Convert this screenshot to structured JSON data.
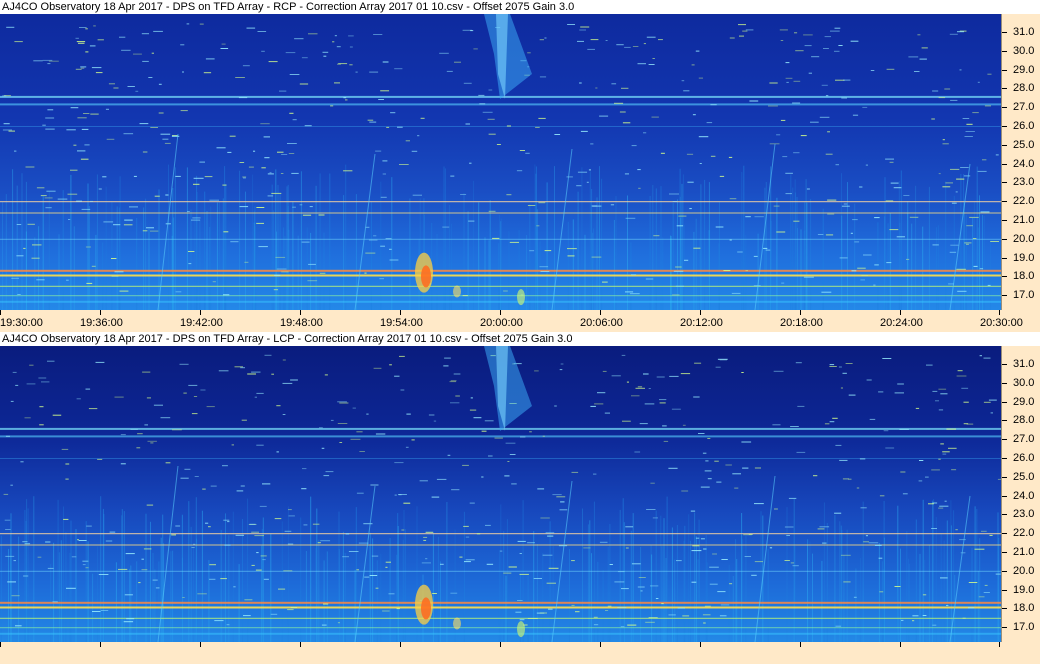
{
  "panels": [
    {
      "title": "AJ4CO Observatory 18 Apr 2017  -  DPS on TFD Array  -  RCP  -  Correction Array 2017 01 10.csv  -  Offset 2075  Gain 3.0",
      "x_tick_labels": [
        "19:30:00",
        "19:36:00",
        "19:42:00",
        "19:48:00",
        "19:54:00",
        "20:00:00",
        "20:06:00",
        "20:12:00",
        "20:18:00",
        "20:24:00",
        "20:30:00"
      ]
    },
    {
      "title": "AJ4CO Observatory 18 Apr 2017  -  DPS on TFD Array  -  LCP  -  Correction Array 2017 01 10.csv  -  Offset 2075  Gain 3.0",
      "x_tick_labels": []
    }
  ],
  "y_tick_labels": [
    "31.0",
    "30.0",
    "29.0",
    "28.0",
    "27.0",
    "26.0",
    "25.0",
    "24.0",
    "23.0",
    "22.0",
    "21.0",
    "20.0",
    "19.0",
    "18.0",
    "17.0"
  ],
  "chart_data": {
    "type": "heatmap",
    "title": "",
    "xlabel": "",
    "ylabel": "",
    "x_range": [
      "19:30:00",
      "20:30:00"
    ],
    "x_ticks": [
      "19:30:00",
      "19:36:00",
      "19:42:00",
      "19:48:00",
      "19:54:00",
      "20:00:00",
      "20:06:00",
      "20:12:00",
      "20:18:00",
      "20:24:00",
      "20:30:00"
    ],
    "y_ticks_mhz": [
      31.0,
      30.0,
      29.0,
      28.0,
      27.0,
      26.0,
      25.0,
      24.0,
      23.0,
      22.0,
      21.0,
      20.0,
      19.0,
      18.0,
      17.0
    ],
    "panels": [
      "RCP",
      "LCP"
    ],
    "colormap": [
      "#0a1d8c",
      "#1540c8",
      "#1e7ae8",
      "#22c8ee",
      "#8af07a",
      "#ffd23c",
      "#ff6a1e"
    ]
  }
}
